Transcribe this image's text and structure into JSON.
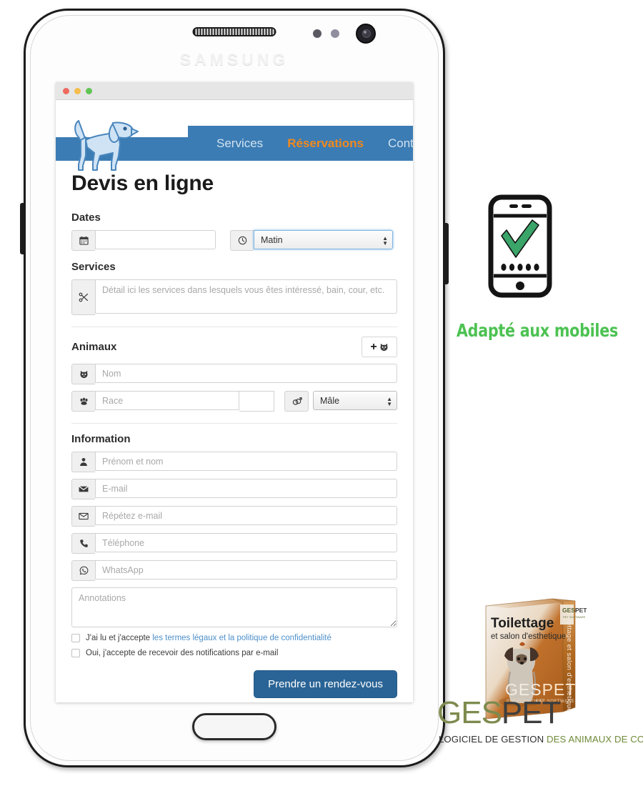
{
  "phone": {
    "brand": "SAMSUNG",
    "speaker_name": "earpiece-speaker",
    "home_button_name": "home-button"
  },
  "browser": {
    "window_dots": [
      "close",
      "minimize",
      "maximize"
    ]
  },
  "site": {
    "logo_alt": "dog-logo",
    "nav": [
      {
        "label": "Services",
        "active": false
      },
      {
        "label": "Réservations",
        "active": true
      },
      {
        "label": "Contact",
        "active": false
      }
    ],
    "nav_color": "#3c7cb4",
    "nav_active_color": "#f0891e"
  },
  "form": {
    "title": "Devis en ligne",
    "sections": {
      "dates": {
        "heading": "Dates",
        "date_value": "",
        "date_icon": "calendar-icon",
        "time_icon": "clock-icon",
        "time_selected": "Matin"
      },
      "services": {
        "heading": "Services",
        "icon": "scissors-icon",
        "placeholder": "Détail ici les services dans lesquels vous êtes intéressé, bain, cour, etc."
      },
      "animaux": {
        "heading": "Animaux",
        "add_button_icon": "plus-pet-icon",
        "name_icon": "pet-face-icon",
        "name_placeholder": "Nom",
        "breed_icon": "paw-icon",
        "breed_placeholder": "Race",
        "gender_icon": "gender-icon",
        "gender_selected": "Mâle"
      },
      "information": {
        "heading": "Information",
        "fields": [
          {
            "icon": "user-icon",
            "placeholder": "Prénom et nom"
          },
          {
            "icon": "envelope-filled-icon",
            "placeholder": "E-mail"
          },
          {
            "icon": "envelope-outline-icon",
            "placeholder": "Répétez e-mail"
          },
          {
            "icon": "phone-icon",
            "placeholder": "Téléphone"
          },
          {
            "icon": "whatsapp-icon",
            "placeholder": "WhatsApp"
          }
        ],
        "annotations_placeholder": "Annotations"
      }
    },
    "consent": {
      "terms_prefix": "J'ai lu et j'accepte ",
      "terms_link": "les termes légaux et la politique de confidentialité",
      "newsletter": "Oui, j'accepte de recevoir des notifications par e-mail"
    },
    "submit_label": "Prendre un rendez-vous",
    "submit_color": "#2a6496"
  },
  "mobile_badge": {
    "icon": "phone-check-icon",
    "caption": "Adapté aux mobiles",
    "caption_color": "#4cc252"
  },
  "product": {
    "box_title": "Toilettage",
    "box_subtitle": "et salon d'esthetique",
    "box_brand_ges": "GES",
    "box_brand_pet": "PET",
    "box_brand_sub": "PET SOFTWARE",
    "spine_brand_ges": "GES",
    "spine_brand_pet": "PET",
    "spine_text": "Toilettage et salon d'esthetique",
    "logo_ges": "GES",
    "logo_pet": "PET",
    "tagline_dark": "LOGICIEL DE GESTION",
    "tagline_green": " DES ANIMAUX DE COMPAGNIE"
  }
}
